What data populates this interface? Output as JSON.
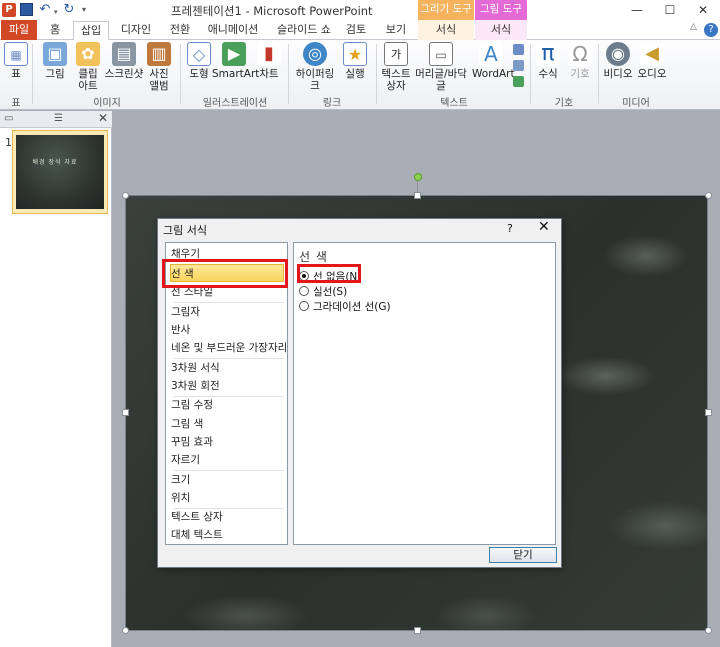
{
  "titlebar": {
    "logo_letter": "P",
    "title": "프레젠테이션1 - Microsoft PowerPoint",
    "ctx_drawing": "그리기 도구",
    "ctx_picture": "그림 도구"
  },
  "tabs": {
    "file": "파일",
    "items": [
      "홈",
      "삽입",
      "디자인",
      "전환",
      "애니메이션",
      "슬라이드 쇼",
      "검토",
      "보기",
      "서식",
      "서식"
    ],
    "active": "삽입"
  },
  "ribbon": {
    "table": "표",
    "picture": "그림",
    "clipart": "클립\n아트",
    "screenshot": "스크린샷",
    "album": "사진\n앨범",
    "shapes": "도형",
    "smartart": "SmartArt",
    "chart": "차트",
    "hyperlink": "하이퍼링크",
    "action": "실행",
    "textbox": "텍스트\n상자",
    "headerfooter": "머리글/바닥글",
    "wordart": "WordArt",
    "equation": "수식",
    "symbol": "기호",
    "video": "비디오",
    "audio": "오디오",
    "groups": {
      "table": "표",
      "images": "이미지",
      "illustrations": "일러스트레이션",
      "links": "링크",
      "text": "텍스트",
      "symbols": "기호",
      "media": "미디어"
    }
  },
  "thumbs": {
    "slide_number": "1",
    "thumb_text": "배경 장식 자료"
  },
  "dialog": {
    "title": "그림 서식",
    "help": "?",
    "close_x": "✕",
    "categories": [
      "채우기",
      "선 색",
      "선 스타일",
      "그림자",
      "반사",
      "네온 및 부드러운 가장자리",
      "3차원 서식",
      "3차원 회전",
      "그림 수정",
      "그림 색",
      "꾸밈 효과",
      "자르기",
      "크기",
      "위치",
      "텍스트 상자",
      "대체 텍스트"
    ],
    "selected_category": "선 색",
    "section_title": "선 색",
    "radios": [
      {
        "label": "선 없음(N)",
        "checked": true
      },
      {
        "label": "실선(S)",
        "checked": false
      },
      {
        "label": "그라데이션 선(G)",
        "checked": false
      }
    ],
    "close_button": "닫기"
  }
}
